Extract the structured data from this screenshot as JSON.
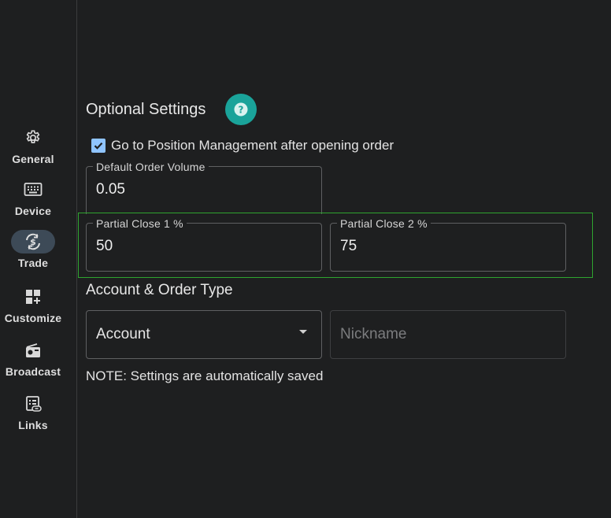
{
  "nav": {
    "items": [
      {
        "label": "General",
        "icon": "gear-icon"
      },
      {
        "label": "Device",
        "icon": "keyboard-icon"
      },
      {
        "label": "Trade",
        "icon": "currency-exchange-icon",
        "active": true
      },
      {
        "label": "Customize",
        "icon": "dashboard-add-icon"
      },
      {
        "label": "Broadcast",
        "icon": "radio-icon"
      },
      {
        "label": "Links",
        "icon": "link-list-icon"
      }
    ]
  },
  "optional": {
    "title": "Optional Settings",
    "help_icon": "help-icon",
    "checkbox_label": "Go to Position Management after opening order",
    "checkbox_checked": true,
    "default_volume": {
      "label": "Default Order Volume",
      "value": "0.05"
    },
    "partial1": {
      "label": "Partial Close 1 %",
      "value": "50"
    },
    "partial2": {
      "label": "Partial Close 2 %",
      "value": "75"
    }
  },
  "account": {
    "title": "Account & Order Type",
    "select_value": "Account",
    "nickname_placeholder": "Nickname"
  },
  "note": "NOTE: Settings are automatically saved",
  "colors": {
    "background": "#1e1f20",
    "accent_teal": "#1aa39a",
    "checkbox_blue": "#8fc4ff",
    "active_nav": "#3d4a57",
    "highlight_green": "#2fa52f"
  }
}
